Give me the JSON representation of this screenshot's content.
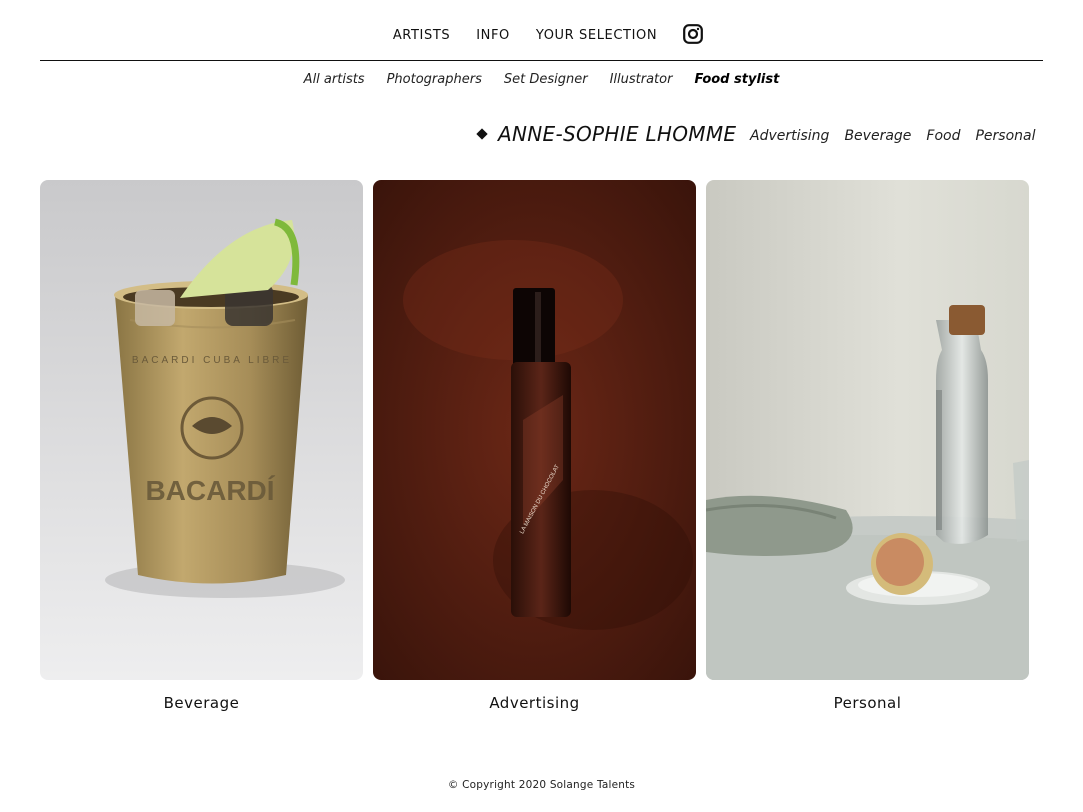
{
  "nav": {
    "items": [
      {
        "label": "ARTISTS"
      },
      {
        "label": "INFO"
      },
      {
        "label": "YOUR SELECTION"
      }
    ],
    "instagram_icon": "instagram-icon"
  },
  "filters": {
    "items": [
      {
        "label": "All artists"
      },
      {
        "label": "Photographers"
      },
      {
        "label": "Set Designer"
      },
      {
        "label": "Illustrator"
      },
      {
        "label": "Food stylist"
      }
    ],
    "active": "Food stylist"
  },
  "artist": {
    "name": "ANNE-SOPHIE LHOMME",
    "categories": [
      {
        "label": "Advertising"
      },
      {
        "label": "Beverage"
      },
      {
        "label": "Food"
      },
      {
        "label": "Personal"
      }
    ]
  },
  "gallery": {
    "items": [
      {
        "caption": "Beverage"
      },
      {
        "caption": "Advertising"
      },
      {
        "caption": "Personal"
      }
    ]
  },
  "footer": {
    "copyright": "© Copyright 2020 Solange Talents"
  },
  "colors": {
    "text": "#111111",
    "background": "#ffffff",
    "rule": "#111111"
  }
}
